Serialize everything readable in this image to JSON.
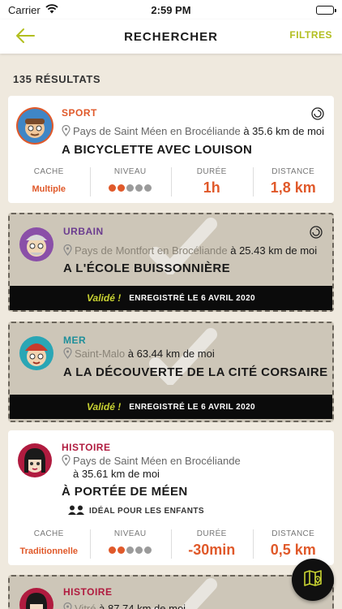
{
  "status": {
    "carrier": "Carrier",
    "time": "2:59 PM"
  },
  "nav": {
    "title": "RECHERCHER",
    "filters": "FILTRES"
  },
  "results_count": "135 RÉSULTATS",
  "stat_labels": {
    "cache": "CACHE",
    "level": "NIVEAU",
    "duration": "DURÉE",
    "distance": "DISTANCE"
  },
  "colors": {
    "accent": "#b2be1f",
    "orange": "#e0592a",
    "sport": "#e0592a",
    "urbain": "#6b3c8f",
    "mer": "#1e8f9a",
    "histoire": "#b01b3f"
  },
  "cards": [
    {
      "category": "SPORT",
      "location": "Pays de Saint Méen en Brocéliande",
      "distance": "à 35.6 km de moi",
      "name": "A BICYCLETTE AVEC LOUISON",
      "cache": "Multiple",
      "level": 2,
      "level_max": 5,
      "duration": "1h",
      "distance_value": "1,8 km"
    },
    {
      "category": "URBAIN",
      "location": "Pays de Montfort en Brocéliande",
      "distance": "à 25.43 km de moi",
      "name": "A L'ÉCOLE BUISSONNIÈRE",
      "validated": "Validé !",
      "recorded": "ENREGISTRÉ LE 6 AVRIL 2020"
    },
    {
      "category": "MER",
      "location": "Saint-Malo",
      "distance": "à 63.44 km de moi",
      "name": "A LA DÉCOUVERTE DE LA CITÉ CORSAIRE",
      "validated": "Validé !",
      "recorded": "ENREGISTRÉ LE 6 AVRIL 2020"
    },
    {
      "category": "HISTOIRE",
      "location": "Pays de Saint Méen en Brocéliande",
      "distance": "à 35.61 km de moi",
      "name": "À PORTÉE DE MÉEN",
      "kids": "IDÉAL POUR LES ENFANTS",
      "cache": "Traditionnelle",
      "level": 2,
      "level_max": 5,
      "duration": "-30min",
      "distance_value": "0,5 km"
    },
    {
      "category": "HISTOIRE",
      "location": "Vitré",
      "distance": "à 87.74 km de moi"
    }
  ]
}
